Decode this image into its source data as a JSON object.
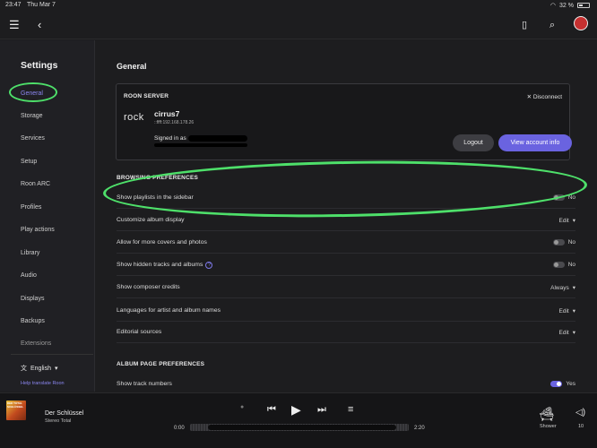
{
  "statusbar": {
    "time": "23:47",
    "date": "Thu Mar 7",
    "battery": "32 %"
  },
  "sidebar": {
    "title": "Settings",
    "items": [
      {
        "label": "General"
      },
      {
        "label": "Storage"
      },
      {
        "label": "Services"
      },
      {
        "label": "Setup"
      },
      {
        "label": "Roon ARC"
      },
      {
        "label": "Profiles"
      },
      {
        "label": "Play actions"
      },
      {
        "label": "Library"
      },
      {
        "label": "Audio"
      },
      {
        "label": "Displays"
      },
      {
        "label": "Backups"
      },
      {
        "label": "Extensions"
      }
    ],
    "language": "English",
    "help_link": "Help translate Roon"
  },
  "main": {
    "title": "General",
    "server": {
      "heading": "ROON SERVER",
      "disconnect": "Disconnect",
      "brand": "rock",
      "name": "cirrus7",
      "ip": "::ffff:192.168.178.26",
      "signed_in": "Signed in as",
      "logout": "Logout",
      "view_account": "View account info"
    },
    "browsing": {
      "heading": "BROWSING PREFERENCES",
      "rows": [
        {
          "label": "Show playlists in the sidebar",
          "value": "No"
        },
        {
          "label": "Customize album display",
          "value": "Edit"
        },
        {
          "label": "Allow for more covers and photos",
          "value": "No"
        },
        {
          "label": "Show hidden tracks and albums",
          "value": "No"
        },
        {
          "label": "Show composer credits",
          "value": "Always"
        },
        {
          "label": "Languages for artist and album names",
          "value": "Edit"
        },
        {
          "label": "Editorial sources",
          "value": "Edit"
        }
      ]
    },
    "album_page": {
      "heading": "ALBUM PAGE PREFERENCES",
      "rows": [
        {
          "label": "Show track numbers",
          "value": "Yes"
        }
      ]
    }
  },
  "player": {
    "cover_text": "DER TOTAL SCHLÜSSEL",
    "track": "Der Schlüssel",
    "artist": "Stereo Total",
    "elapsed": "0:00",
    "duration": "2:20",
    "zone": "Shower",
    "volume": "10"
  },
  "colors": {
    "accent": "#6a63e0",
    "highlight": "#4ee06a",
    "background": "#1d1d1f"
  }
}
